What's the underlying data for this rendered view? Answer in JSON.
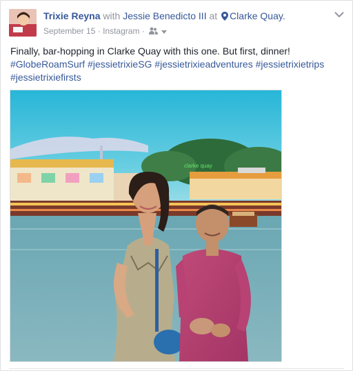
{
  "post": {
    "author": "Trixie Reyna",
    "with_word": "with",
    "tagged": "Jessie Benedicto III",
    "at_word": "at",
    "location": "Clarke Quay.",
    "date": "September 15",
    "separator": "·",
    "source": "Instagram",
    "audience_icon": "friends-icon",
    "message": "Finally, bar-hopping in Clarke Quay with this one. But first, dinner!",
    "hashtags": "#GlobeRoamSurf #jessietrixieSG #jessietrixieadventures #jessietrixietrips #jessietrixiefirsts"
  },
  "photo": {
    "sign_text": "clarke quay"
  },
  "colors": {
    "link": "#365899",
    "text": "#1d2129",
    "muted": "#90949c",
    "card_border": "#dddfe2"
  },
  "icons": {
    "options": "chevron-down-icon",
    "location": "map-pin-icon"
  }
}
